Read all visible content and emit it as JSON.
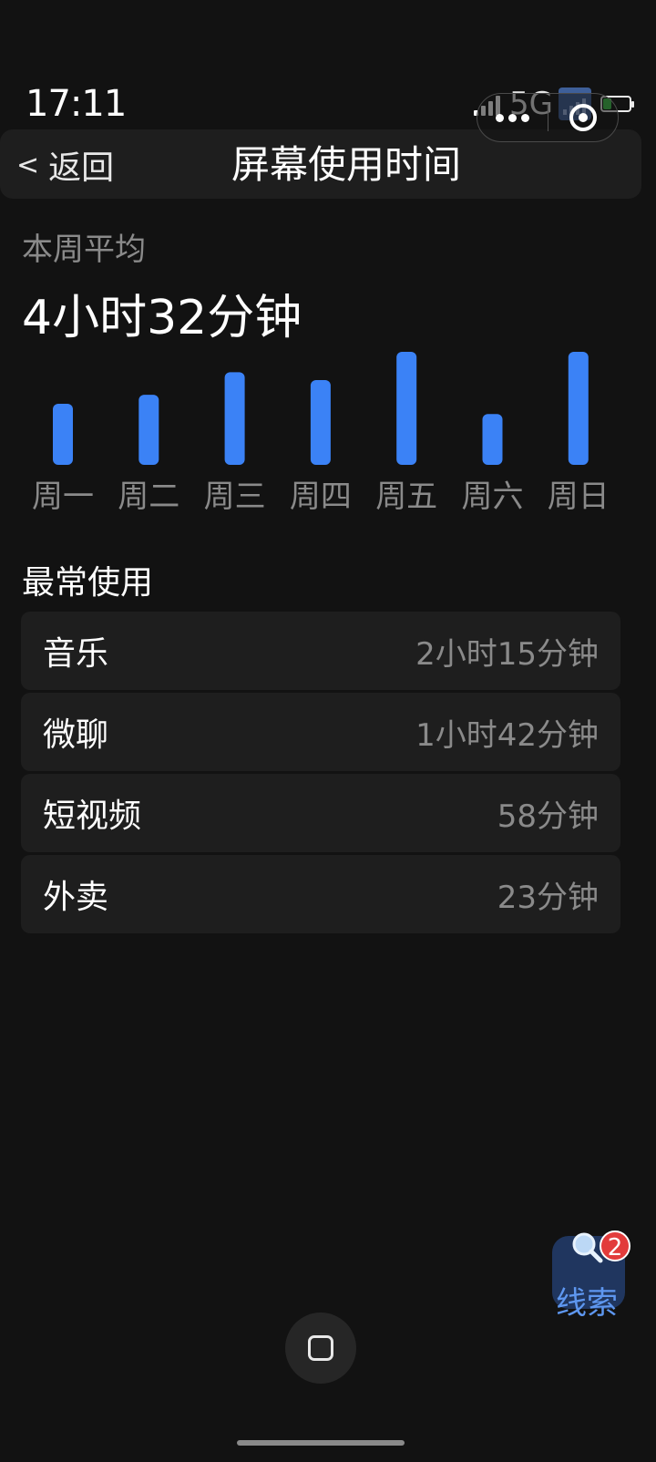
{
  "status_bar": {
    "time": "17:11",
    "network": "5G",
    "icons": [
      "signal-icon",
      "signal-box-icon",
      "battery-icon"
    ],
    "battery_color": "#3cc44a"
  },
  "capsule": {
    "icons": [
      "more-dots-icon",
      "close-target-icon"
    ]
  },
  "header": {
    "back_label": "返回",
    "back_icon": "<",
    "title": "屏幕使用时间"
  },
  "summary": {
    "label": "本周平均",
    "value": "4小时32分钟"
  },
  "chart_data": {
    "type": "bar",
    "categories": [
      "周一",
      "周二",
      "周三",
      "周四",
      "周五",
      "周六",
      "周日"
    ],
    "values": [
      0.54,
      0.62,
      0.82,
      0.75,
      1.0,
      0.45,
      1.0
    ],
    "value_unit": "fraction of tallest bar",
    "bar_color": "#3b82f6",
    "ylim": [
      0,
      1
    ],
    "title": "",
    "xlabel": "",
    "ylabel": ""
  },
  "most_used": {
    "title": "最常使用",
    "apps": [
      {
        "name": "音乐",
        "time": "2小时15分钟"
      },
      {
        "name": "微聊",
        "time": "1小时42分钟"
      },
      {
        "name": "短视频",
        "time": "58分钟"
      },
      {
        "name": "外卖",
        "time": "23分钟"
      }
    ]
  },
  "clue": {
    "label": "线索",
    "badge": "2",
    "icon": "magnifier-icon",
    "accent": "#5e97f0"
  },
  "accent_color": "#3b82f6"
}
